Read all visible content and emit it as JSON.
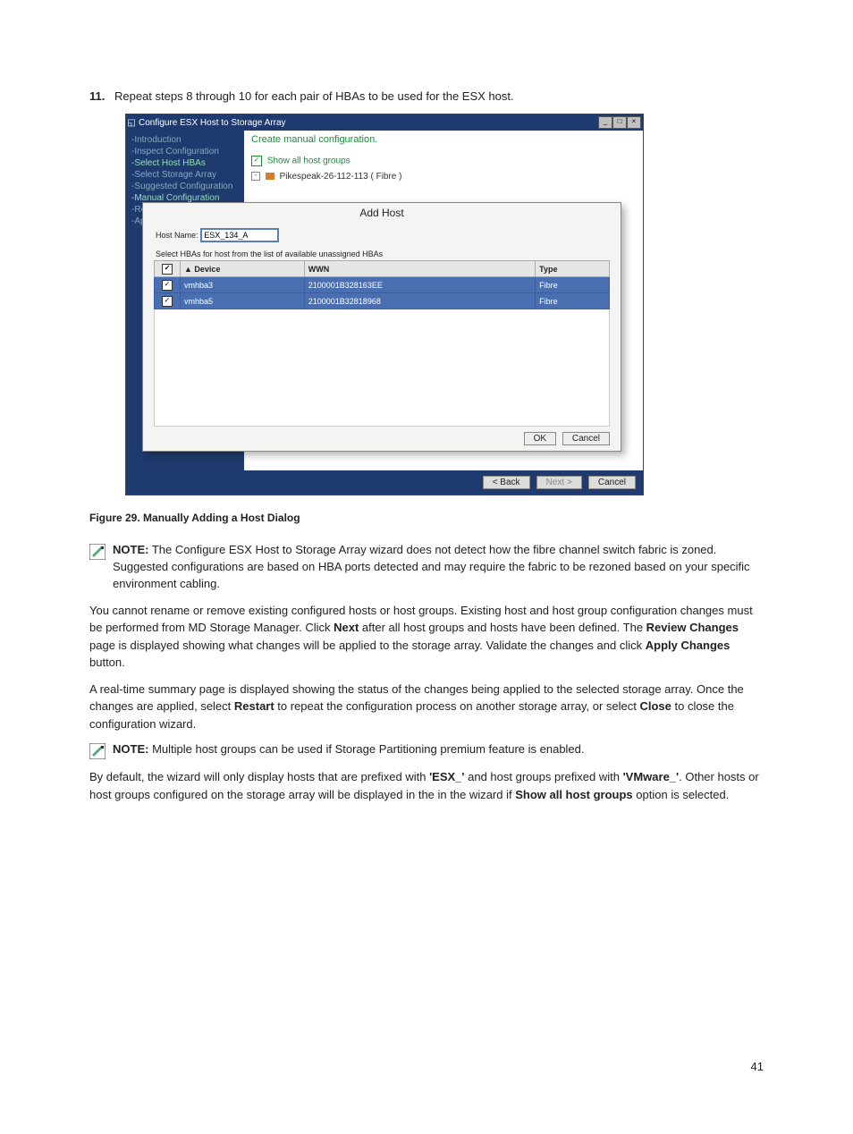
{
  "step": {
    "number": "11.",
    "text": "Repeat steps 8 through 10 for each pair of HBAs to be used for the ESX host."
  },
  "window": {
    "title": "Configure ESX Host to Storage Array",
    "nav": {
      "items": [
        "Introduction",
        "Inspect Configuration",
        "Select Host HBAs",
        "Select Storage Array",
        "Suggested Configuration",
        "Manual Configuration",
        "Re",
        "Ap"
      ]
    },
    "main": {
      "create_link": "Create manual configuration.",
      "show_all_label": "Show all host groups",
      "tree_item": "Pikespeak-26-112-113 ( Fibre )"
    }
  },
  "add_host": {
    "title": "Add Host",
    "host_name_label": "Host Name:",
    "host_name_value": "ESX_134_A",
    "select_text": "Select HBAs for host from the list of available unassigned HBAs",
    "columns": {
      "device": "Device",
      "wwn": "WWN",
      "type": "Type"
    },
    "rows": [
      {
        "device": "vmhba3",
        "wwn": "2100001B328163EE",
        "type": "Fibre"
      },
      {
        "device": "vmhba5",
        "wwn": "2100001B32818968",
        "type": "Fibre"
      }
    ],
    "ok": "OK",
    "cancel": "Cancel"
  },
  "footer": {
    "back": "< Back",
    "next": "Next >",
    "cancel": "Cancel"
  },
  "figure_caption": "Figure 29. Manually Adding a Host Dialog",
  "note1": {
    "label": "NOTE:",
    "text": " The Configure ESX Host to Storage Array wizard does not detect how the fibre channel switch fabric is zoned. Suggested configurations are based on HBA ports detected and may require the fabric to be rezoned based on your specific environment cabling."
  },
  "para1": {
    "p1a": "You cannot rename or remove existing configured hosts or host groups. Existing host and host group configuration changes must be performed from MD Storage Manager. Click ",
    "p1b": "Next",
    "p1c": " after all host groups and hosts have been defined. The ",
    "p1d": "Review Changes",
    "p1e": " page is displayed showing what changes will be applied to the storage array. Validate the changes and click ",
    "p1f": "Apply Changes",
    "p1g": " button."
  },
  "para2": {
    "p2a": "A real-time summary page is displayed showing the status of the changes being applied to the selected storage array. Once the changes are applied, select ",
    "p2b": "Restart",
    "p2c": " to repeat the configuration process on another storage array, or select ",
    "p2d": "Close",
    "p2e": " to close the configuration wizard."
  },
  "note2": {
    "label": "NOTE:",
    "text": " Multiple host groups can be used if Storage Partitioning premium feature is enabled."
  },
  "para3": {
    "p3a": "By default, the wizard will only display hosts that are prefixed with ",
    "p3b": "'ESX_'",
    "p3c": " and host groups prefixed with ",
    "p3d": "'VMware_'",
    "p3e": ". Other hosts or host groups configured on the storage array will be displayed in the in the wizard if ",
    "p3f": "Show all host groups",
    "p3g": " option is selected."
  },
  "page_number": "41"
}
